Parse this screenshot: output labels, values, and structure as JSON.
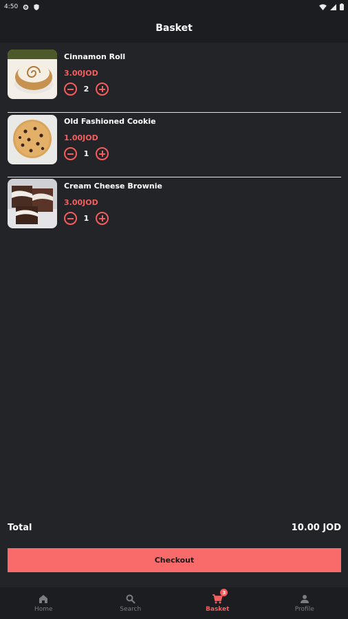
{
  "status_bar": {
    "time": "4:50"
  },
  "app_bar": {
    "title": "Basket"
  },
  "basket": {
    "items": [
      {
        "name": "Cinnamon Roll",
        "price": "3.00JOD",
        "quantity": "2"
      },
      {
        "name": "Old Fashioned Cookie",
        "price": "1.00JOD",
        "quantity": "1"
      },
      {
        "name": "Cream Cheese Brownie",
        "price": "3.00JOD",
        "quantity": "1"
      }
    ]
  },
  "summary": {
    "total_label": "Total",
    "total_value": "10.00 JOD"
  },
  "checkout": {
    "label": "Checkout"
  },
  "nav": {
    "items": [
      {
        "label": "Home",
        "icon": "home-icon"
      },
      {
        "label": "Search",
        "icon": "search-icon"
      },
      {
        "label": "Basket",
        "icon": "cart-icon",
        "badge": "3",
        "active": true
      },
      {
        "label": "Profile",
        "icon": "person-icon"
      }
    ]
  },
  "colors": {
    "accent": "#f45e5e",
    "button": "#f96b6b",
    "background": "#232427",
    "bar": "#1c1d20"
  }
}
